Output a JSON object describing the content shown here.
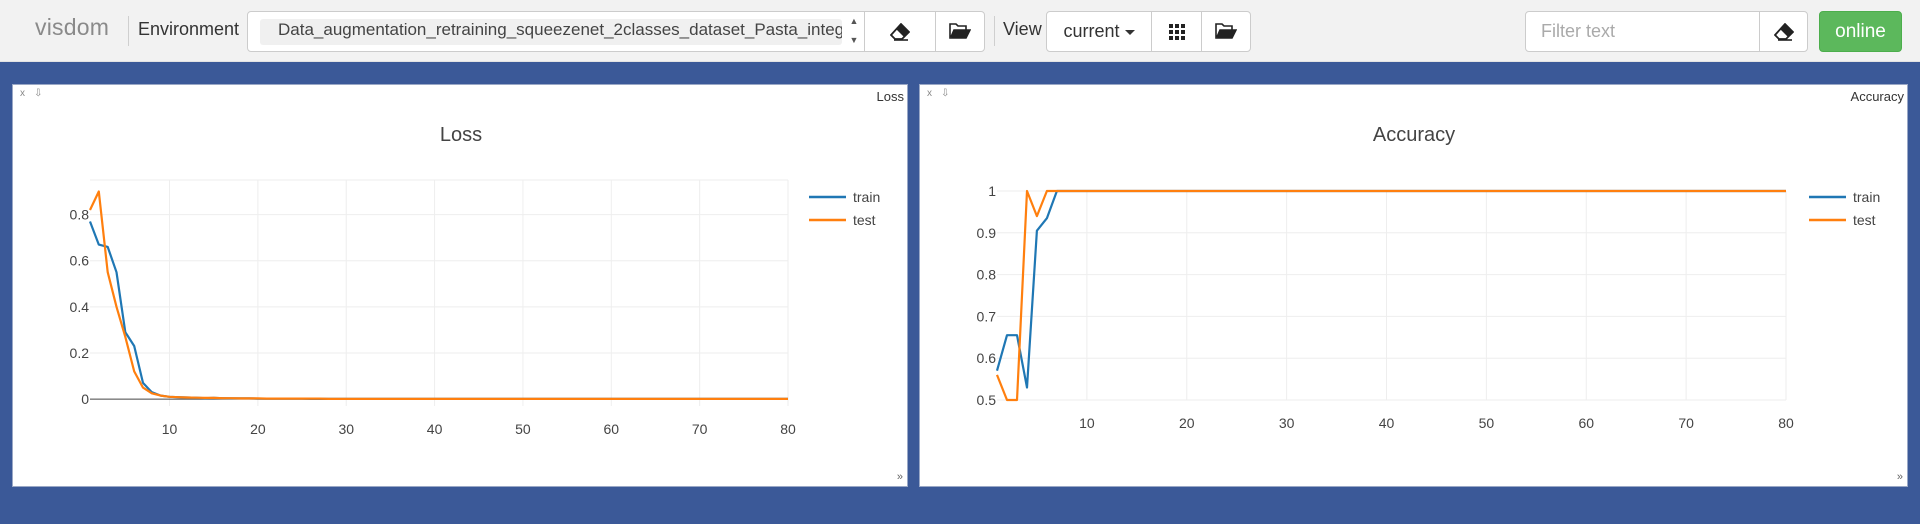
{
  "navbar": {
    "brand": "visdom",
    "environment_label": "Environment",
    "environment_value": "Data_augmentation_retraining_squeezenet_2classes_dataset_Pasta_integ",
    "view_label": "View",
    "view_value": "current",
    "filter_placeholder": "Filter text",
    "status": "online",
    "status_color": "#5cb85c"
  },
  "panes": {
    "loss": {
      "pane_title": "Loss",
      "close": "x",
      "download": "⇩",
      "resize": "»"
    },
    "accuracy": {
      "pane_title": "Accuracy",
      "close": "x",
      "download": "⇩",
      "resize": "»"
    }
  },
  "chart_data": [
    {
      "type": "line",
      "title": "Loss",
      "xlabel": "",
      "ylabel": "",
      "xlim": [
        1,
        80
      ],
      "ylim": [
        -0.03,
        0.95
      ],
      "xticks": [
        10,
        20,
        30,
        40,
        50,
        60,
        70,
        80
      ],
      "yticks": [
        0,
        0.2,
        0.4,
        0.6,
        0.8
      ],
      "grid": true,
      "legend": "top-right",
      "x": [
        1,
        2,
        3,
        4,
        5,
        6,
        7,
        8,
        9,
        10,
        11,
        12,
        13,
        14,
        15,
        16,
        17,
        18,
        19,
        20,
        21,
        22,
        23,
        24,
        25,
        26,
        27,
        28,
        29,
        30,
        31,
        32,
        33,
        34,
        35,
        36,
        37,
        38,
        39,
        40,
        41,
        42,
        43,
        44,
        45,
        46,
        47,
        48,
        49,
        50,
        51,
        52,
        53,
        54,
        55,
        56,
        57,
        58,
        59,
        60,
        61,
        62,
        63,
        64,
        65,
        66,
        67,
        68,
        69,
        70,
        71,
        72,
        73,
        74,
        75,
        76,
        77,
        78,
        79,
        80
      ],
      "series": [
        {
          "name": "train",
          "color": "#1f77b4",
          "values": [
            0.77,
            0.67,
            0.66,
            0.55,
            0.29,
            0.23,
            0.07,
            0.03,
            0.015,
            0.01,
            0.008,
            0.007,
            0.006,
            0.004,
            0.005,
            0.004,
            0.003,
            0.003,
            0.003,
            0.002,
            0.002,
            0.002,
            0.002,
            0.002,
            0.002,
            0.001,
            0.001,
            0.001,
            0.001,
            0.001,
            0.001,
            0.001,
            0.001,
            0.001,
            0.001,
            0.001,
            0.001,
            0.001,
            0.001,
            0.001,
            0.001,
            0.001,
            0.001,
            0.001,
            0.001,
            0.001,
            0.001,
            0.001,
            0.001,
            0.001,
            0.001,
            0.001,
            0.001,
            0.001,
            0.001,
            0.001,
            0.001,
            0.001,
            0.001,
            0.001,
            0.001,
            0.001,
            0.001,
            0.001,
            0.001,
            0.001,
            0.001,
            0.001,
            0.001,
            0.001,
            0.001,
            0.001,
            0.001,
            0.001,
            0.001,
            0.001,
            0.001,
            0.001,
            0.001,
            0.001
          ]
        },
        {
          "name": "test",
          "color": "#ff7f0e",
          "values": [
            0.82,
            0.9,
            0.55,
            0.4,
            0.27,
            0.12,
            0.05,
            0.025,
            0.015,
            0.01,
            0.008,
            0.007,
            0.006,
            0.005,
            0.005,
            0.004,
            0.004,
            0.003,
            0.003,
            0.003,
            0.002,
            0.002,
            0.002,
            0.002,
            0.002,
            0.002,
            0.002,
            0.001,
            0.001,
            0.001,
            0.001,
            0.001,
            0.001,
            0.001,
            0.001,
            0.001,
            0.001,
            0.001,
            0.001,
            0.001,
            0.001,
            0.001,
            0.001,
            0.001,
            0.001,
            0.001,
            0.001,
            0.001,
            0.001,
            0.001,
            0.001,
            0.001,
            0.001,
            0.001,
            0.001,
            0.001,
            0.001,
            0.001,
            0.001,
            0.001,
            0.001,
            0.001,
            0.001,
            0.001,
            0.001,
            0.001,
            0.001,
            0.001,
            0.001,
            0.001,
            0.001,
            0.001,
            0.001,
            0.001,
            0.001,
            0.001,
            0.001,
            0.001,
            0.001,
            0.001
          ]
        }
      ]
    },
    {
      "type": "line",
      "title": "Accuracy",
      "xlabel": "",
      "ylabel": "",
      "xlim": [
        1,
        80
      ],
      "ylim": [
        0.5,
        1.0
      ],
      "xticks": [
        10,
        20,
        30,
        40,
        50,
        60,
        70,
        80
      ],
      "yticks": [
        0.5,
        0.6,
        0.7,
        0.8,
        0.9,
        1
      ],
      "grid": true,
      "legend": "top-right",
      "x": [
        1,
        2,
        3,
        4,
        5,
        6,
        7,
        8,
        9,
        10,
        11,
        12,
        13,
        14,
        15,
        16,
        17,
        18,
        19,
        20,
        21,
        22,
        23,
        24,
        25,
        26,
        27,
        28,
        29,
        30,
        31,
        32,
        33,
        34,
        35,
        36,
        37,
        38,
        39,
        40,
        41,
        42,
        43,
        44,
        45,
        46,
        47,
        48,
        49,
        50,
        51,
        52,
        53,
        54,
        55,
        56,
        57,
        58,
        59,
        60,
        61,
        62,
        63,
        64,
        65,
        66,
        67,
        68,
        69,
        70,
        71,
        72,
        73,
        74,
        75,
        76,
        77,
        78,
        79,
        80
      ],
      "series": [
        {
          "name": "train",
          "color": "#1f77b4",
          "values": [
            0.57,
            0.655,
            0.655,
            0.53,
            0.905,
            0.935,
            1,
            1,
            1,
            1,
            1,
            1,
            1,
            1,
            1,
            1,
            1,
            1,
            1,
            1,
            1,
            1,
            1,
            1,
            1,
            1,
            1,
            1,
            1,
            1,
            1,
            1,
            1,
            1,
            1,
            1,
            1,
            1,
            1,
            1,
            1,
            1,
            1,
            1,
            1,
            1,
            1,
            1,
            1,
            1,
            1,
            1,
            1,
            1,
            1,
            1,
            1,
            1,
            1,
            1,
            1,
            1,
            1,
            1,
            1,
            1,
            1,
            1,
            1,
            1,
            1,
            1,
            1,
            1,
            1,
            1,
            1,
            1,
            1,
            1
          ]
        },
        {
          "name": "test",
          "color": "#ff7f0e",
          "values": [
            0.56,
            0.5,
            0.5,
            1,
            0.94,
            1,
            1,
            1,
            1,
            1,
            1,
            1,
            1,
            1,
            1,
            1,
            1,
            1,
            1,
            1,
            1,
            1,
            1,
            1,
            1,
            1,
            1,
            1,
            1,
            1,
            1,
            1,
            1,
            1,
            1,
            1,
            1,
            1,
            1,
            1,
            1,
            1,
            1,
            1,
            1,
            1,
            1,
            1,
            1,
            1,
            1,
            1,
            1,
            1,
            1,
            1,
            1,
            1,
            1,
            1,
            1,
            1,
            1,
            1,
            1,
            1,
            1,
            1,
            1,
            1,
            1,
            1,
            1,
            1,
            1,
            1,
            1,
            1,
            1,
            1
          ]
        }
      ]
    }
  ]
}
